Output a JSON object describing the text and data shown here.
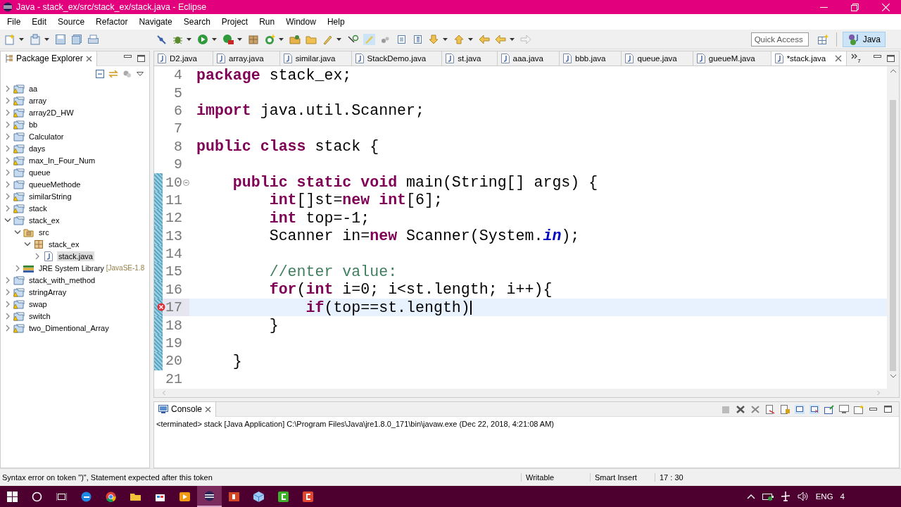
{
  "window": {
    "title": "Java - stack_ex/src/stack_ex/stack.java - Eclipse"
  },
  "menu": [
    "File",
    "Edit",
    "Source",
    "Refactor",
    "Navigate",
    "Search",
    "Project",
    "Run",
    "Window",
    "Help"
  ],
  "quick_access": {
    "placeholder": "Quick Access"
  },
  "perspective": {
    "label": "Java",
    "selected": true
  },
  "package_explorer": {
    "title": "Package Explorer",
    "items": [
      {
        "label": "aa",
        "kind": "project",
        "warning": true,
        "expanded": false,
        "selected": false
      },
      {
        "label": "array",
        "kind": "project",
        "warning": true,
        "expanded": false,
        "selected": false
      },
      {
        "label": "array2D_HW",
        "kind": "project",
        "warning": true,
        "expanded": false,
        "selected": false
      },
      {
        "label": "bb",
        "kind": "project",
        "warning": true,
        "expanded": false,
        "selected": false
      },
      {
        "label": "Calculator",
        "kind": "project",
        "warning": false,
        "expanded": false,
        "selected": false
      },
      {
        "label": "days",
        "kind": "project",
        "warning": true,
        "expanded": false,
        "selected": false
      },
      {
        "label": "max_In_Four_Num",
        "kind": "project",
        "warning": true,
        "expanded": false,
        "selected": false
      },
      {
        "label": "queue",
        "kind": "project",
        "warning": false,
        "expanded": false,
        "selected": false
      },
      {
        "label": "queueMethode",
        "kind": "project",
        "warning": false,
        "expanded": false,
        "selected": false
      },
      {
        "label": "similarString",
        "kind": "project",
        "warning": true,
        "expanded": false,
        "selected": false
      },
      {
        "label": "stack",
        "kind": "project",
        "warning": true,
        "expanded": false,
        "selected": false
      },
      {
        "label": "stack_ex",
        "kind": "project",
        "warning": false,
        "expanded": true,
        "selected": false,
        "children": [
          {
            "label": "src",
            "kind": "source-folder",
            "expanded": true,
            "selected": false,
            "children": [
              {
                "label": "stack_ex",
                "kind": "package",
                "expanded": true,
                "selected": false,
                "children": [
                  {
                    "label": "stack.java",
                    "kind": "java-file",
                    "expanded": false,
                    "selected": true
                  }
                ]
              }
            ]
          },
          {
            "label": "JRE System Library",
            "decoration": "[JavaSE-1.8",
            "kind": "library",
            "expanded": false,
            "selected": false
          }
        ]
      },
      {
        "label": "stack_with_method",
        "kind": "project",
        "warning": false,
        "expanded": false,
        "selected": false
      },
      {
        "label": "stringArray",
        "kind": "project",
        "warning": true,
        "expanded": false,
        "selected": false
      },
      {
        "label": "swap",
        "kind": "project",
        "warning": true,
        "expanded": false,
        "selected": false
      },
      {
        "label": "switch",
        "kind": "project",
        "warning": true,
        "expanded": false,
        "selected": false
      },
      {
        "label": "two_Dimentional_Array",
        "kind": "project",
        "warning": true,
        "expanded": false,
        "selected": false
      }
    ]
  },
  "editor": {
    "tabs": [
      {
        "label": "D2.java",
        "selected": false
      },
      {
        "label": "array.java",
        "selected": false
      },
      {
        "label": "similar.java",
        "selected": false
      },
      {
        "label": "StackDemo.java",
        "selected": false
      },
      {
        "label": "st.java",
        "selected": false
      },
      {
        "label": "aaa.java",
        "selected": false
      },
      {
        "label": "bbb.java",
        "selected": false
      },
      {
        "label": "queue.java",
        "selected": false
      },
      {
        "label": "gueueM.java",
        "selected": false
      },
      {
        "label": "*stack.java",
        "selected": true
      }
    ],
    "overflow_count": "7",
    "lines": [
      {
        "number": "4",
        "current": false,
        "changed": false,
        "error": false,
        "foldable": false,
        "tokens": [
          {
            "kind": "keyword",
            "text": "package"
          },
          {
            "kind": "plain",
            "text": " stack_ex;"
          }
        ]
      },
      {
        "number": "5",
        "current": false,
        "changed": false,
        "error": false,
        "foldable": false
      },
      {
        "number": "6",
        "current": false,
        "changed": false,
        "error": false,
        "foldable": false,
        "tokens": [
          {
            "kind": "keyword",
            "text": "import"
          },
          {
            "kind": "plain",
            "text": " java.util.Scanner;"
          }
        ]
      },
      {
        "number": "7",
        "current": false,
        "changed": false,
        "error": false,
        "foldable": false
      },
      {
        "number": "8",
        "current": false,
        "changed": false,
        "error": false,
        "foldable": false,
        "tokens": [
          {
            "kind": "keyword",
            "text": "public class"
          },
          {
            "kind": "plain",
            "text": " stack {"
          }
        ]
      },
      {
        "number": "9",
        "current": false,
        "changed": false,
        "error": false,
        "foldable": false
      },
      {
        "number": "10",
        "current": false,
        "changed": true,
        "error": false,
        "foldable": true,
        "tokens": [
          {
            "kind": "keyword",
            "text": "    public static void"
          },
          {
            "kind": "plain",
            "text": " main(String[] args) {"
          }
        ]
      },
      {
        "number": "11",
        "current": false,
        "changed": true,
        "error": false,
        "foldable": false,
        "tokens": [
          {
            "kind": "keyword",
            "text": "        int"
          },
          {
            "kind": "plain",
            "text": "[]st="
          },
          {
            "kind": "keyword",
            "text": "new int"
          },
          {
            "kind": "plain",
            "text": "[6];"
          }
        ]
      },
      {
        "number": "12",
        "current": false,
        "changed": true,
        "error": false,
        "foldable": false,
        "tokens": [
          {
            "kind": "keyword",
            "text": "        int"
          },
          {
            "kind": "plain",
            "text": " top=-1;"
          }
        ]
      },
      {
        "number": "13",
        "current": false,
        "changed": true,
        "error": false,
        "foldable": false,
        "tokens": [
          {
            "kind": "plain",
            "text": "        Scanner in="
          },
          {
            "kind": "keyword",
            "text": "new"
          },
          {
            "kind": "plain",
            "text": " Scanner(System."
          },
          {
            "kind": "static",
            "text": "in"
          },
          {
            "kind": "plain",
            "text": ");"
          }
        ]
      },
      {
        "number": "14",
        "current": false,
        "changed": true,
        "error": false,
        "foldable": false
      },
      {
        "number": "15",
        "current": false,
        "changed": true,
        "error": false,
        "foldable": false,
        "tokens": [
          {
            "kind": "comment",
            "text": "        //enter value:"
          }
        ]
      },
      {
        "number": "16",
        "current": false,
        "changed": true,
        "error": false,
        "foldable": false,
        "tokens": [
          {
            "kind": "keyword",
            "text": "        for"
          },
          {
            "kind": "plain",
            "text": "("
          },
          {
            "kind": "keyword",
            "text": "int"
          },
          {
            "kind": "plain",
            "text": " i=0; i<st.length; i++){"
          }
        ]
      },
      {
        "number": "17",
        "current": true,
        "changed": true,
        "error": true,
        "foldable": false,
        "tokens": [
          {
            "kind": "keyword",
            "text": "            if"
          },
          {
            "kind": "plain",
            "text": "(top==st.length)"
          }
        ]
      },
      {
        "number": "18",
        "current": false,
        "changed": true,
        "error": false,
        "foldable": false,
        "tokens": [
          {
            "kind": "plain",
            "text": "        }"
          }
        ]
      },
      {
        "number": "19",
        "current": false,
        "changed": true,
        "error": false,
        "foldable": false
      },
      {
        "number": "20",
        "current": false,
        "changed": true,
        "error": false,
        "foldable": false,
        "tokens": [
          {
            "kind": "plain",
            "text": "    }"
          }
        ]
      },
      {
        "number": "21",
        "current": false,
        "changed": false,
        "error": false,
        "foldable": false
      }
    ]
  },
  "console": {
    "title": "Console",
    "status": "<terminated> stack [Java Application] C:\\Program Files\\Java\\jre1.8.0_171\\bin\\javaw.exe (Dec 22, 2018, 4:21:08 AM)"
  },
  "status_bar": {
    "message": "Syntax error on token \")\", Statement expected after this token",
    "writable": "Writable",
    "insert_mode": "Smart Insert",
    "position": "17 : 30"
  },
  "taskbar": {
    "language": "ENG",
    "clock": "4"
  }
}
